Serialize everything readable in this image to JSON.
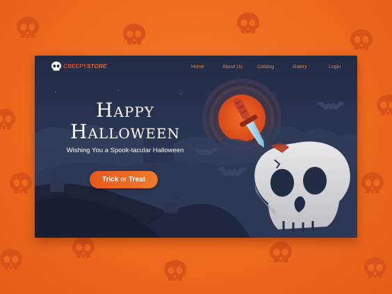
{
  "colors": {
    "page_background": "#ee6a1e",
    "panel_background": "#232c45",
    "accent": "#ef7d35",
    "moon": "#e8561c",
    "skull": "#d9d9dc"
  },
  "brand": {
    "name_prefix": "CREEPY",
    "name_suffix": "STORE",
    "logo_icon": "skull-icon"
  },
  "nav": {
    "items": [
      "Home",
      "About Us",
      "Catalog",
      "Galery",
      "Login"
    ]
  },
  "hero": {
    "title_line1": "Happy",
    "title_line2": "Halloween",
    "subtitle": "Wishing You a Spook-tacular Halloween",
    "cta_word1": "Trick",
    "cta_word2": "or",
    "cta_word3": "Treat"
  },
  "illustration": {
    "icons": [
      "skull-icon",
      "dagger-icon",
      "moon-icon",
      "bat-icon",
      "tombstone-icon",
      "cross-icon"
    ]
  }
}
